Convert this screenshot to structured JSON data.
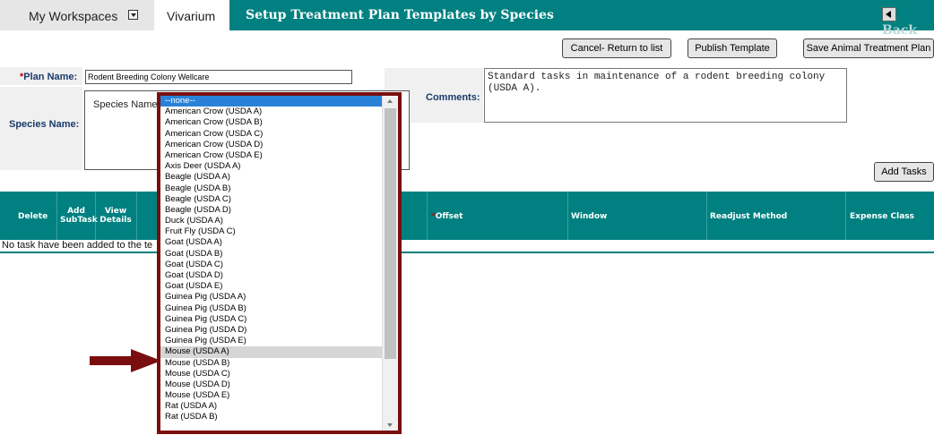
{
  "nav": {
    "workspaces_label": "My Workspaces",
    "vivarium_label": "Vivarium",
    "page_title": "Setup Treatment Plan Templates by Species",
    "back_label": "Back"
  },
  "actions": {
    "cancel": "Cancel- Return to list",
    "publish": "Publish Template",
    "save": "Save Animal Treatment Plan",
    "add_tasks": "Add Tasks"
  },
  "form": {
    "plan_name_required": "*",
    "plan_name_label": "Plan Name:",
    "plan_name_value": "Rodent Breeding Colony Wellcare",
    "species_name_label": "Species Name:",
    "species_inner_label": "Species Name:",
    "comments_label": "Comments:",
    "comments_value": "Standard tasks in maintenance of a rodent breeding colony\n(USDA A)."
  },
  "table": {
    "headers": {
      "delete": "Delete",
      "add_subtask_1": "Add",
      "add_subtask_2": "SubTask",
      "view_details_1": "View",
      "view_details_2": "Details",
      "offset_required": "*",
      "offset": "Offset",
      "window": "Window",
      "readjust": "Readjust Method",
      "expense": "Expense Class"
    },
    "empty_message": "No task have been added to the te"
  },
  "species_dropdown": {
    "selected": "--none--",
    "highlighted": "Mouse (USDA A)",
    "options": [
      "--none--",
      "American Crow (USDA A)",
      "American Crow (USDA B)",
      "American Crow (USDA C)",
      "American Crow (USDA D)",
      "American Crow (USDA E)",
      "Axis Deer (USDA A)",
      "Beagle (USDA A)",
      "Beagle (USDA B)",
      "Beagle (USDA C)",
      "Beagle (USDA D)",
      "Duck (USDA A)",
      "Fruit Fly (USDA C)",
      "Goat (USDA A)",
      "Goat (USDA B)",
      "Goat (USDA C)",
      "Goat (USDA D)",
      "Goat (USDA E)",
      "Guinea Pig (USDA A)",
      "Guinea Pig (USDA B)",
      "Guinea Pig (USDA C)",
      "Guinea Pig (USDA D)",
      "Guinea Pig (USDA E)",
      "Mouse (USDA A)",
      "Mouse (USDA B)",
      "Mouse (USDA C)",
      "Mouse (USDA D)",
      "Mouse (USDA E)",
      "Rat (USDA A)",
      "Rat (USDA B)"
    ]
  },
  "colors": {
    "header_teal": "#008080",
    "arrow_maroon": "#7a0e0e",
    "selected_blue": "#2a82d8",
    "required_red": "#cc0000"
  }
}
